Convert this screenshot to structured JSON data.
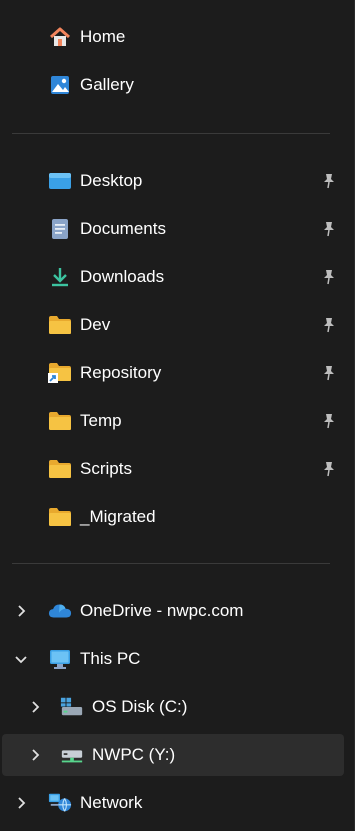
{
  "quick": [
    {
      "label": "Home",
      "icon": "home-icon"
    },
    {
      "label": "Gallery",
      "icon": "gallery-icon"
    }
  ],
  "pinned": [
    {
      "label": "Desktop",
      "icon": "desktop-folder-icon",
      "pinned": true
    },
    {
      "label": "Documents",
      "icon": "documents-icon",
      "pinned": true
    },
    {
      "label": "Downloads",
      "icon": "download-icon",
      "pinned": true
    },
    {
      "label": "Dev",
      "icon": "folder-icon",
      "pinned": true
    },
    {
      "label": "Repository",
      "icon": "folder-shortcut-icon",
      "pinned": true
    },
    {
      "label": "Temp",
      "icon": "folder-icon",
      "pinned": true
    },
    {
      "label": "Scripts",
      "icon": "folder-icon",
      "pinned": true
    },
    {
      "label": "_Migrated",
      "icon": "folder-icon",
      "pinned": false
    }
  ],
  "tree": {
    "onedrive": {
      "label": "OneDrive - nwpc.com",
      "icon": "onedrive-cloud-icon",
      "expanded": false
    },
    "this_pc": {
      "label": "This PC",
      "icon": "monitor-icon",
      "expanded": true
    },
    "os_disk": {
      "label": "OS Disk (C:)",
      "icon": "windows-drive-icon",
      "expanded": false
    },
    "nwpc": {
      "label": "NWPC (Y:)",
      "icon": "network-drive-icon",
      "expanded": false,
      "selected": true
    },
    "network": {
      "label": "Network",
      "icon": "network-icon",
      "expanded": false
    }
  },
  "colors": {
    "background": "#1c1c1c",
    "selected": "#2d2d2d",
    "divider": "#3a3a3a",
    "folder": "#f6c343",
    "accent": "#4aa3df"
  }
}
